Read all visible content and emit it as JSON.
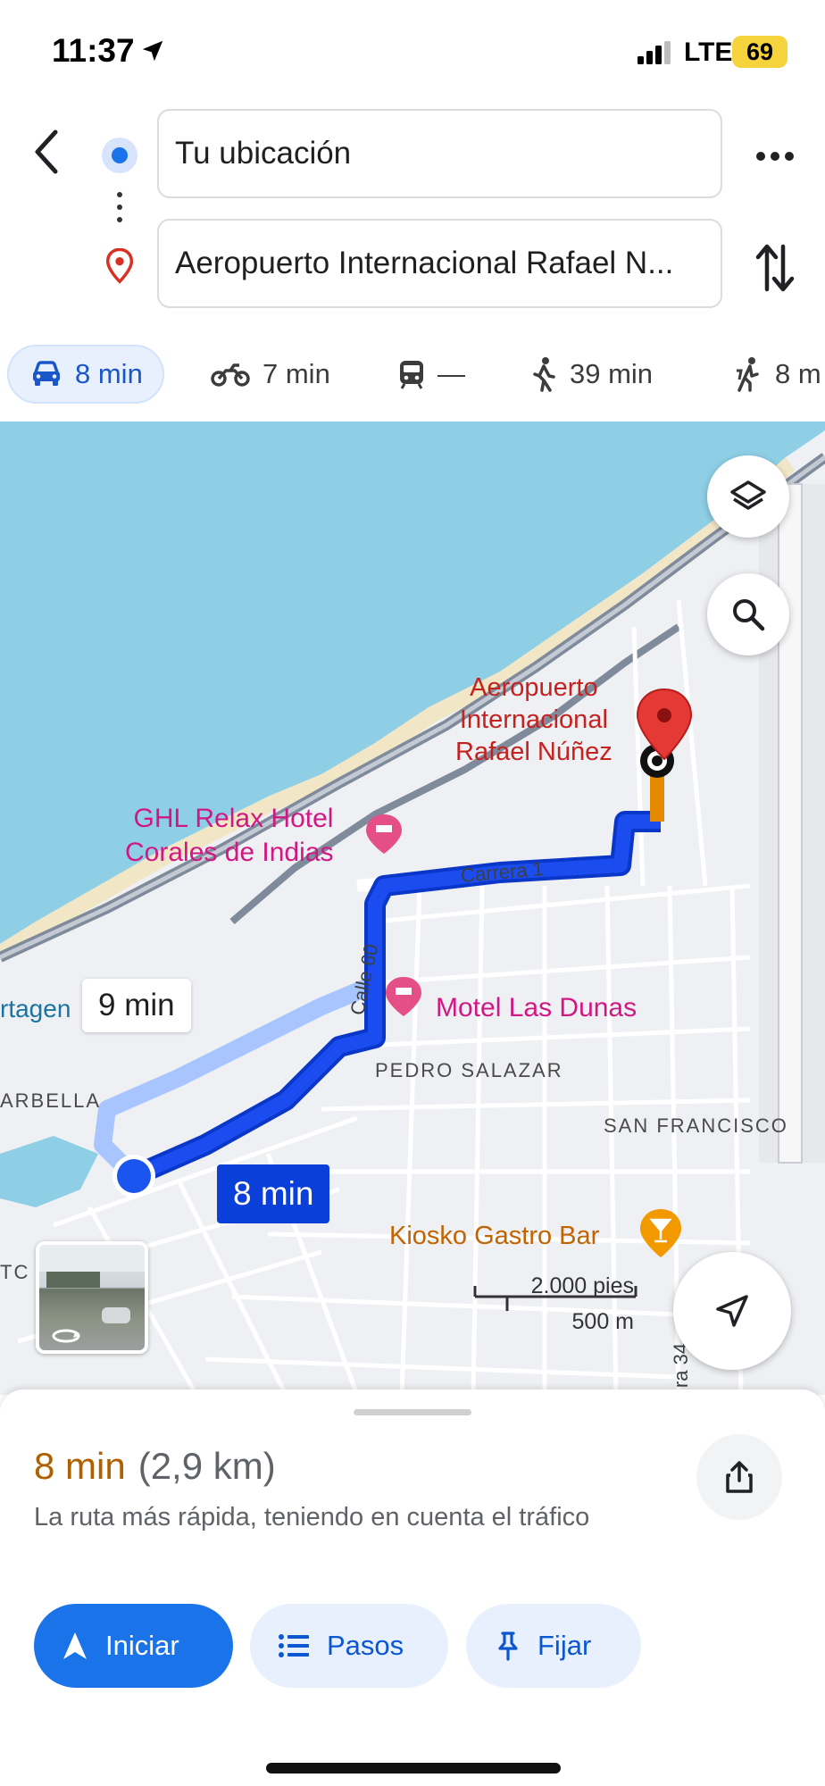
{
  "status": {
    "time": "11:37",
    "network": "LTE",
    "battery": "69"
  },
  "directions": {
    "origin": "Tu ubicación",
    "destination": "Aeropuerto Internacional Rafael N..."
  },
  "modes": [
    {
      "icon": "car-icon",
      "label": "8 min",
      "active": true
    },
    {
      "icon": "motorcycle-icon",
      "label": "7 min"
    },
    {
      "icon": "transit-icon",
      "label": "—"
    },
    {
      "icon": "walk-icon",
      "label": "39 min"
    },
    {
      "icon": "ride-icon",
      "label": "8 m"
    }
  ],
  "map": {
    "destination_label": [
      "Aeropuerto",
      "Internacional",
      "Rafael Núñez"
    ],
    "hotel_label": [
      "GHL Relax Hotel",
      "Corales de Indias"
    ],
    "motel_label": "Motel Las Dunas",
    "bar_label": "Kiosko Gastro Bar",
    "areas": {
      "pedro_salazar": "PEDRO SALAZAR",
      "san_francisco": "SAN FRANCISCO",
      "marbella": "ARBELLA",
      "cartagena": "rtagen",
      "tc": "TC"
    },
    "streets": {
      "carrera1": "Carrera 1",
      "calle60": "Calle 60",
      "carrera34": "ra 34"
    },
    "alt_route_time": "9 min",
    "main_route_time": "8 min",
    "scale": {
      "imperial": "2.000 pies",
      "metric": "500 m"
    },
    "colors": {
      "water": "#8ecfe6",
      "route": "#1a4cf0",
      "alt_route": "#a9c5ff"
    }
  },
  "sheet": {
    "duration": "8 min",
    "distance": "(2,9 km)",
    "note": "La ruta más rápida, teniendo en cuenta el tráfico",
    "actions": {
      "start": "Iniciar",
      "steps": "Pasos",
      "pin": "Fijar"
    }
  }
}
